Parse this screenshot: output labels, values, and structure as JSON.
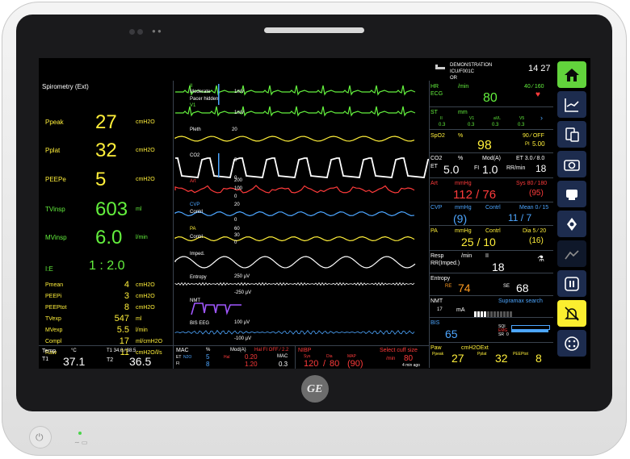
{
  "header": {
    "patient_icon": "bed-icon",
    "patient_name": "DEMONSTRATION",
    "care_unit": "ICU/F001C",
    "location": "OR",
    "clock": "14 27"
  },
  "spirometry": {
    "title": "Spirometry (Ext)",
    "big_params": [
      {
        "label": "Ppeak",
        "value": "27",
        "unit": "cmH2O"
      },
      {
        "label": "Pplat",
        "value": "32",
        "unit": "cmH2O"
      },
      {
        "label": "PEEPe",
        "value": "5",
        "unit": "cmH2O"
      },
      {
        "label": "TVinsp",
        "value": "603",
        "unit": "ml"
      },
      {
        "label": "MVinsp",
        "value": "6.0",
        "unit": "l/min"
      },
      {
        "label": "I:E",
        "value": "1 : 2.0",
        "unit": ""
      }
    ],
    "small_params": [
      {
        "label": "Pmean",
        "value": "4",
        "unit": "cmH2O"
      },
      {
        "label": "PEEPi",
        "value": "3",
        "unit": "cmH2O"
      },
      {
        "label": "PEEPtot",
        "value": "8",
        "unit": "cmH2O"
      },
      {
        "label": "TVexp",
        "value": "547",
        "unit": "ml"
      },
      {
        "label": "MVexp",
        "value": "5.5",
        "unit": "l/min"
      },
      {
        "label": "Compl",
        "value": "17",
        "unit": "ml/cmH2O"
      },
      {
        "label": "Raw",
        "value": "11",
        "unit": "cmH2O/l/s"
      }
    ]
  },
  "waves": {
    "ecg": {
      "lead1": "II",
      "lead1_note": "Moderate",
      "scale1": "1mV",
      "pacer": "Pacer hidden",
      "lead2": "V1",
      "scale2": "1mV"
    },
    "pleth": {
      "label": "Pleth",
      "scale": "20"
    },
    "co2": {
      "label": "CO2",
      "top": "5",
      "bottom": "0"
    },
    "art": {
      "label": "Art",
      "top": "200",
      "mid": "100",
      "bottom": "0"
    },
    "cvp": {
      "label": "CVP",
      "top": "20",
      "contrl": "Contrl",
      "bottom": "0"
    },
    "pa": {
      "label": "PA",
      "top": "60",
      "mid": "30",
      "contrl": "Contrl",
      "bottom": "0"
    },
    "imped": {
      "label": "Imped."
    },
    "entropy": {
      "label": "Entropy",
      "top": "250 µV",
      "bottom": "-250 µV"
    },
    "nmt": {
      "label": "NMT"
    },
    "bis": {
      "label": "BIS EEG",
      "top": "100 µV",
      "bottom": "-100 µV"
    }
  },
  "right": {
    "hr": {
      "label": "HR",
      "unit": "/min",
      "source": "ECG",
      "alarm": "40 ⁄ 160",
      "value": "80",
      "icon": "heart-icon"
    },
    "st": {
      "label": "ST",
      "unit": "mm",
      "leads": [
        "II",
        "V1",
        "aVL",
        "V5"
      ],
      "values": [
        "0.3",
        "0.3",
        "0.3",
        "0.3"
      ]
    },
    "spo2": {
      "label": "SpO2",
      "unit": "%",
      "alarm": "90 ⁄ OFF",
      "pi_label": "PI",
      "pi": "5.00",
      "value": "98"
    },
    "co2": {
      "label": "CO2",
      "unit": "%",
      "et_label": "ET",
      "value": "5.0",
      "fi_label": "FI",
      "mod": "Mod(A)",
      "fi": "1.0",
      "et_range": "ET 3.0 ⁄ 8.0",
      "rr_label": "RR/min",
      "rr": "18"
    },
    "art": {
      "label": "Art",
      "unit": "mmHg",
      "value": "112 / 76",
      "sys_label": "Sys 80 ⁄ 180",
      "mean": "(95)"
    },
    "cvp": {
      "label": "CVP",
      "unit": "mmHg",
      "mean": "(9)",
      "contrl": "Contrl",
      "mean_label": "Mean 0 ⁄ 15",
      "contrl_value": "11 / 7"
    },
    "pa": {
      "label": "PA",
      "unit": "mmHg",
      "contrl": "Contrl",
      "value": "25 / 10",
      "dia_label": "Dia 5 ⁄ 20",
      "mean": "(16)"
    },
    "resp": {
      "label": "Resp",
      "unit": "/min",
      "lead": "II",
      "source": "RR(Imped.)",
      "value": "18",
      "icon": "lungs-icon"
    },
    "entropy": {
      "label": "Entropy",
      "re_label": "RE",
      "re": "74",
      "se_label": "SE",
      "se": "68"
    },
    "nmt": {
      "label": "NMT",
      "current": "17",
      "unit": "mA",
      "mode": "Supramax search"
    },
    "bis": {
      "label": "BIS",
      "value": "65",
      "sqi": "SQI",
      "emg": "EMG",
      "sr": "SR",
      "sr_value": "0"
    },
    "paw": {
      "label": "Paw",
      "unit": "cmH2OExt",
      "ppeak_label": "Ppeak",
      "ppeak": "27",
      "pplat_label": "Pplat",
      "pplat": "32",
      "peeptot_label": "PEEPtot",
      "peeptot": "8"
    }
  },
  "bottom": {
    "temp": {
      "label": "Temp",
      "unit": "°C",
      "t1": "T1",
      "t1_value": "37.1",
      "t2": "T2",
      "t2_value": "36.5",
      "range": "T1 34.0 ⁄ 38.5"
    },
    "mac": {
      "label": "MAC",
      "pct": "%",
      "mod": "Mod(A)",
      "alarm": "Hal FI OFF ⁄ 2.2",
      "et": "ET",
      "fi": "FI",
      "n2o": "N2O",
      "n2o_et": "5",
      "n2o_fi": "8",
      "hal": "Hal",
      "hal_et": "0.20",
      "hal_fi": "1.20",
      "mac": "MAC",
      "mac_value": "0.3"
    },
    "nibp": {
      "label": "NIBP",
      "message": "Select cuff size",
      "sys": "Sys",
      "dia": "Dia",
      "map": "MAP",
      "sys_value": "120",
      "dia_value": "80",
      "map_value": "(90)",
      "interval_label": "/min",
      "interval": "80",
      "ago": "4 min ago"
    }
  },
  "sidebar": {
    "buttons": [
      "home-icon",
      "trend-icon",
      "devices-icon",
      "camera-icon",
      "monitor-icon",
      "hemodynamic-icon",
      "procedures-icon",
      "pause-icon",
      "alarm-silence-icon",
      "menu-icon"
    ]
  },
  "device": {
    "brand": "GE",
    "power_icon": "power-icon",
    "ac_icon": "ac-power-icon",
    "battery_icon": "battery-icon"
  },
  "colors": {
    "ecg": "#63ef3d",
    "pleth": "#ffef3a",
    "art": "#ff3b3b",
    "cvp": "#4da6ff",
    "pa": "#ffef3a",
    "nmt": "#a057ff",
    "sidebar": "#1d2c4e",
    "home_button": "#62d33c",
    "alarm_button": "#fbee2f"
  }
}
